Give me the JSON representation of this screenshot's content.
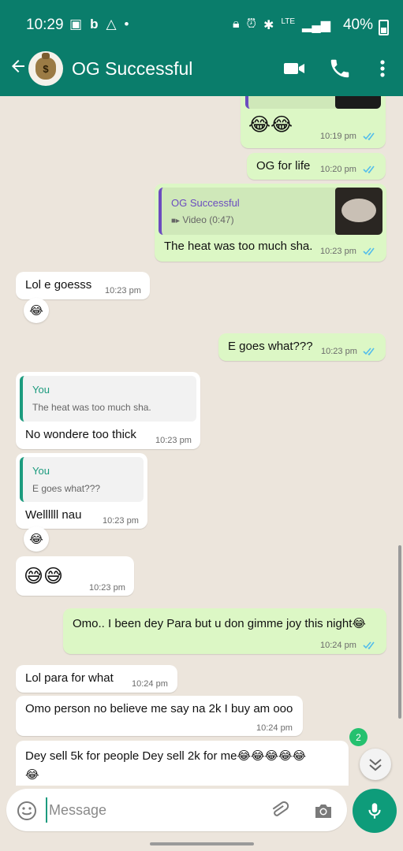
{
  "status_bar": {
    "time": "10:29",
    "network": "LTE",
    "battery": "40%"
  },
  "header": {
    "contact_name": "OG Successful",
    "avatar_symbol": "$"
  },
  "messages": [
    {
      "id": "m1",
      "direction": "out",
      "text": "😂😂",
      "time": "10:19 pm"
    },
    {
      "id": "m2",
      "direction": "out",
      "text": "OG for life",
      "time": "10:20 pm"
    },
    {
      "id": "m3",
      "direction": "out",
      "text": "The heat was too much sha.",
      "time": "10:23 pm",
      "quote": {
        "author": "OG Successful",
        "text": "Video (0:47)"
      }
    },
    {
      "id": "m4",
      "direction": "in",
      "text": "Lol e goesss",
      "time": "10:23 pm",
      "reaction": "😂"
    },
    {
      "id": "m5",
      "direction": "out",
      "text": "E goes what???",
      "time": "10:23 pm"
    },
    {
      "id": "m6",
      "direction": "in",
      "text": "No wondere too thick",
      "time": "10:23 pm",
      "quote": {
        "author": "You",
        "text": "The heat was too much sha."
      }
    },
    {
      "id": "m7",
      "direction": "in",
      "text": "Wellllll nau",
      "time": "10:23 pm",
      "quote": {
        "author": "You",
        "text": "E goes what???"
      },
      "reaction": "😂"
    },
    {
      "id": "m8",
      "direction": "in",
      "text": "😅😅",
      "time": "10:23 pm"
    },
    {
      "id": "m9",
      "direction": "out",
      "text": "Omo.. I been dey Para but u don gimme joy this night😂",
      "time": "10:24 pm"
    },
    {
      "id": "m10",
      "direction": "in",
      "text": "Lol para for what",
      "time": "10:24 pm"
    },
    {
      "id": "m11",
      "direction": "in",
      "text": "Omo person no believe me say na 2k I buy am ooo",
      "time": "10:24 pm"
    },
    {
      "id": "m12",
      "direction": "in",
      "text": "Dey sell 5k for people Dey sell 2k for me😂😂😂😂😂",
      "text2": "😂"
    }
  ],
  "unread_count": "2",
  "composer": {
    "placeholder": "Message"
  },
  "colors": {
    "header": "#0a7d6b",
    "outgoing_bubble": "#dcf7c5",
    "incoming_bubble": "#ffffff",
    "accent": "#0e9c7a",
    "read_ticks": "#53bdeb"
  }
}
